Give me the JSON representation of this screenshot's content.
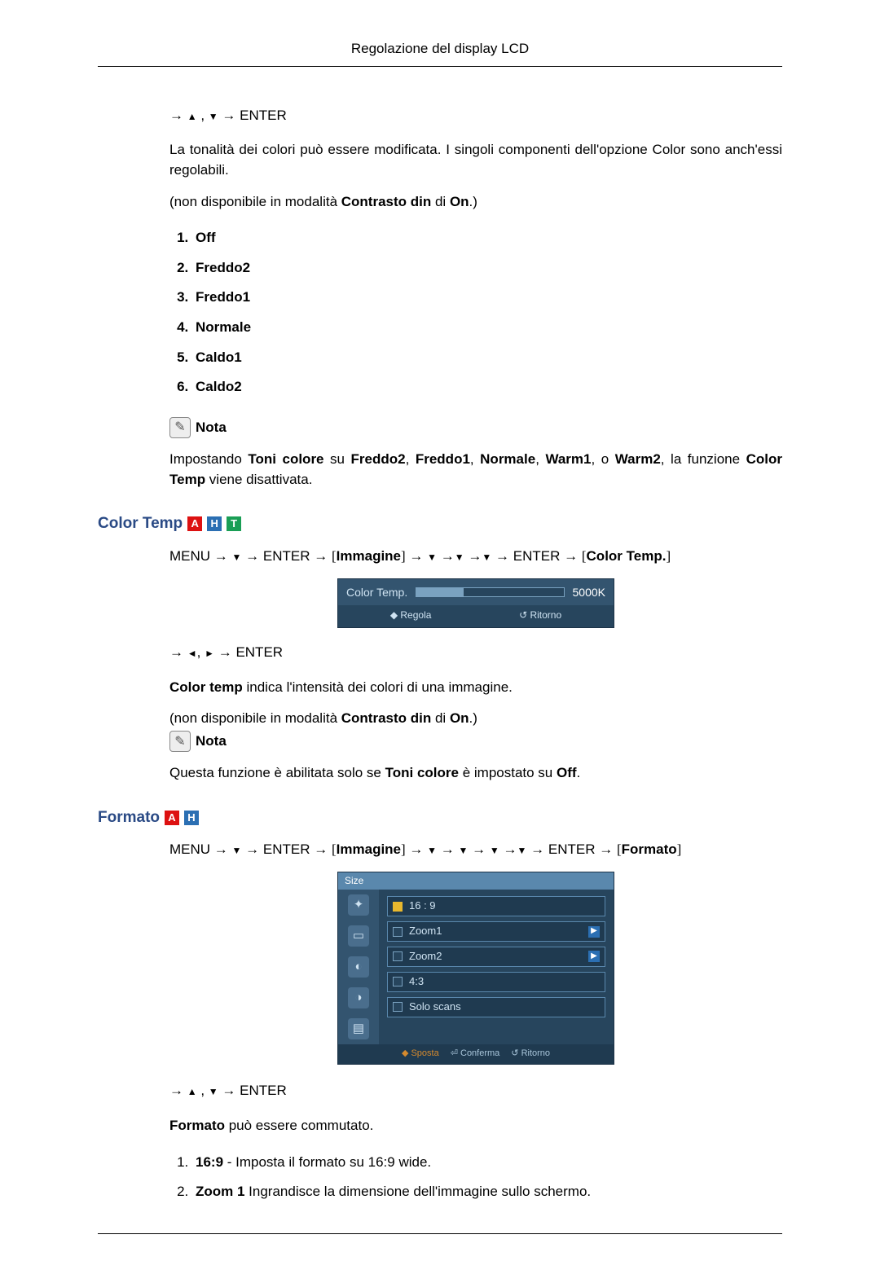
{
  "header": {
    "title": "Regolazione del display LCD"
  },
  "seq_enter_updown": "ENTER",
  "intro": {
    "p1": "La tonalità dei colori può essere modificata. I singoli componenti dell'opzione Color sono anch'essi regolabili.",
    "p2_pre": "(non disponibile in modalità ",
    "p2_bold": "Contrasto din",
    "p2_mid": " di ",
    "p2_bold2": "On",
    "p2_post": ".)"
  },
  "tone_options": [
    "Off",
    "Freddo2",
    "Freddo1",
    "Normale",
    "Caldo1",
    "Caldo2"
  ],
  "note_label": "Nota",
  "tone_note": {
    "pre": "Impostando ",
    "b1": "Toni colore",
    "mid1": " su ",
    "b2": "Freddo2",
    "c1": ", ",
    "b3": "Freddo1",
    "c2": ", ",
    "b4": "Normale",
    "c3": ", ",
    "b5": "Warm1",
    "c4": ", o ",
    "b6": "Warm2",
    "mid2": ", la funzione ",
    "b7": "Color Temp",
    "post": " viene disattivata."
  },
  "color_temp": {
    "heading": "Color Temp",
    "tags": [
      "A",
      "H",
      "T"
    ],
    "path": {
      "menu": "MENU",
      "enter": "ENTER",
      "immagine": "Immagine",
      "label": "Color Temp."
    },
    "slider": {
      "label": "Color Temp.",
      "value": "5000K",
      "hint_adjust": "Regola",
      "hint_return": "Ritorno"
    },
    "seq2_enter": "ENTER",
    "desc_b": "Color temp",
    "desc_rest": " indica l'intensità dei colori di una immagine.",
    "na_pre": "(non disponibile in modalità ",
    "na_b1": "Contrasto din",
    "na_mid": " di ",
    "na_b2": "On",
    "na_post": ".)",
    "note2": {
      "pre": "Questa funzione è abilitata solo se ",
      "b1": "Toni colore",
      "mid": " è impostato su ",
      "b2": "Off",
      "post": "."
    }
  },
  "formato": {
    "heading": "Formato",
    "tags": [
      "A",
      "H"
    ],
    "path": {
      "menu": "MENU",
      "enter": "ENTER",
      "immagine": "Immagine",
      "label": "Formato"
    },
    "osd": {
      "title": "Size",
      "items": [
        {
          "label": "16 : 9",
          "selected": true,
          "arrow": false
        },
        {
          "label": "Zoom1",
          "selected": false,
          "arrow": true
        },
        {
          "label": "Zoom2",
          "selected": false,
          "arrow": true
        },
        {
          "label": "4:3",
          "selected": false,
          "arrow": false
        },
        {
          "label": "Solo scans",
          "selected": false,
          "arrow": false
        }
      ],
      "footer": {
        "sposta": "Sposta",
        "conferma": "Conferma",
        "ritorno": "Ritorno"
      }
    },
    "seq_enter": "ENTER",
    "desc_b": "Formato",
    "desc_rest": " può essere commutato.",
    "list": [
      {
        "b": "16:9",
        "rest": " - Imposta il formato su 16:9 wide."
      },
      {
        "b": "Zoom 1",
        "rest": " Ingrandisce la dimensione dell'immagine sullo schermo."
      }
    ]
  }
}
